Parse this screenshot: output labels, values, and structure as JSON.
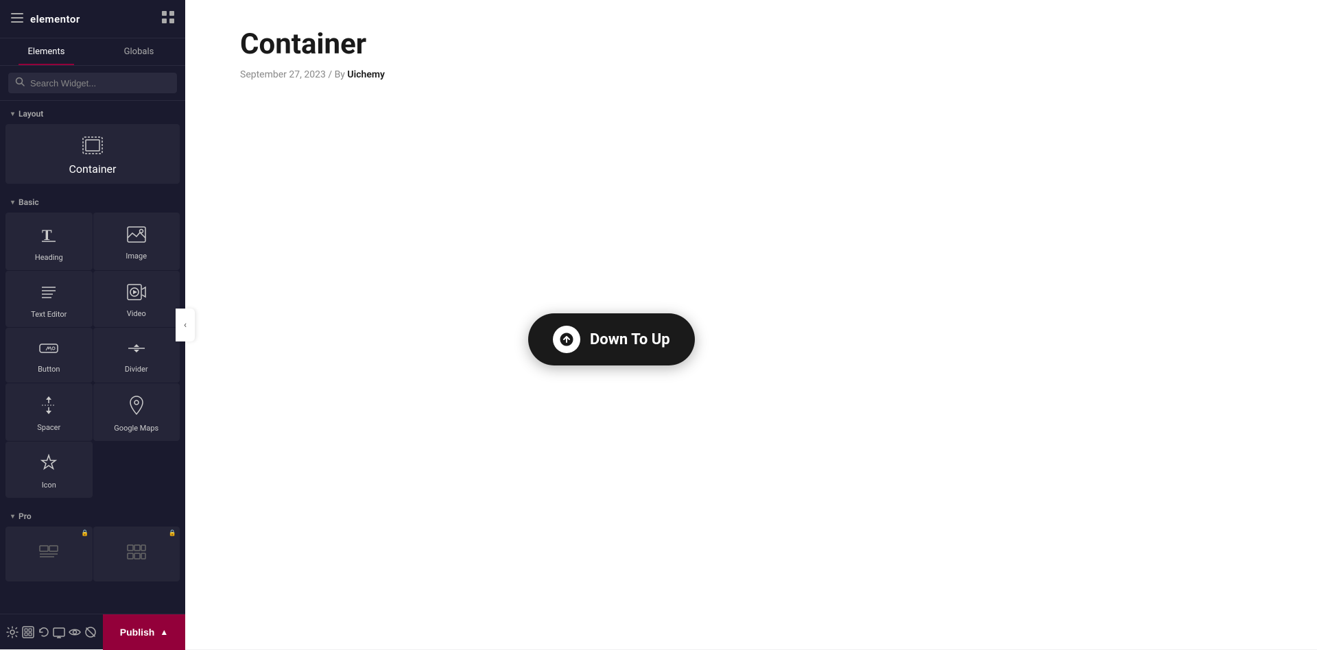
{
  "app": {
    "title": "elementor"
  },
  "sidebar": {
    "tabs": [
      {
        "id": "elements",
        "label": "Elements",
        "active": true
      },
      {
        "id": "globals",
        "label": "Globals",
        "active": false
      }
    ],
    "search": {
      "placeholder": "Search Widget..."
    },
    "sections": {
      "layout": {
        "title": "Layout",
        "widgets": [
          {
            "id": "container",
            "label": "Container",
            "icon": "container"
          }
        ]
      },
      "basic": {
        "title": "Basic",
        "widgets": [
          {
            "id": "heading",
            "label": "Heading",
            "icon": "heading"
          },
          {
            "id": "image",
            "label": "Image",
            "icon": "image"
          },
          {
            "id": "text-editor",
            "label": "Text Editor",
            "icon": "text-editor"
          },
          {
            "id": "video",
            "label": "Video",
            "icon": "video"
          },
          {
            "id": "button",
            "label": "Button",
            "icon": "button"
          },
          {
            "id": "divider",
            "label": "Divider",
            "icon": "divider"
          },
          {
            "id": "spacer",
            "label": "Spacer",
            "icon": "spacer"
          },
          {
            "id": "google-maps",
            "label": "Google Maps",
            "icon": "google-maps"
          },
          {
            "id": "icon",
            "label": "Icon",
            "icon": "icon"
          }
        ]
      },
      "pro": {
        "title": "Pro",
        "widgets": [
          {
            "id": "pro-1",
            "label": "",
            "icon": "pro-list",
            "locked": true
          },
          {
            "id": "pro-2",
            "label": "",
            "icon": "pro-grid",
            "locked": true
          }
        ]
      }
    },
    "bottom": {
      "icons": [
        {
          "id": "settings",
          "icon": "gear"
        },
        {
          "id": "theme",
          "icon": "layers"
        },
        {
          "id": "history",
          "icon": "history"
        },
        {
          "id": "preview",
          "icon": "preview"
        },
        {
          "id": "responsive",
          "icon": "responsive"
        },
        {
          "id": "eye",
          "icon": "eye"
        }
      ],
      "publish_label": "Publish"
    }
  },
  "canvas": {
    "page_title": "Container",
    "page_meta": "September 27, 2023",
    "meta_separator": "/",
    "meta_by": "By",
    "author": "Uichemy",
    "cta_button": {
      "label": "Down To Up"
    }
  }
}
